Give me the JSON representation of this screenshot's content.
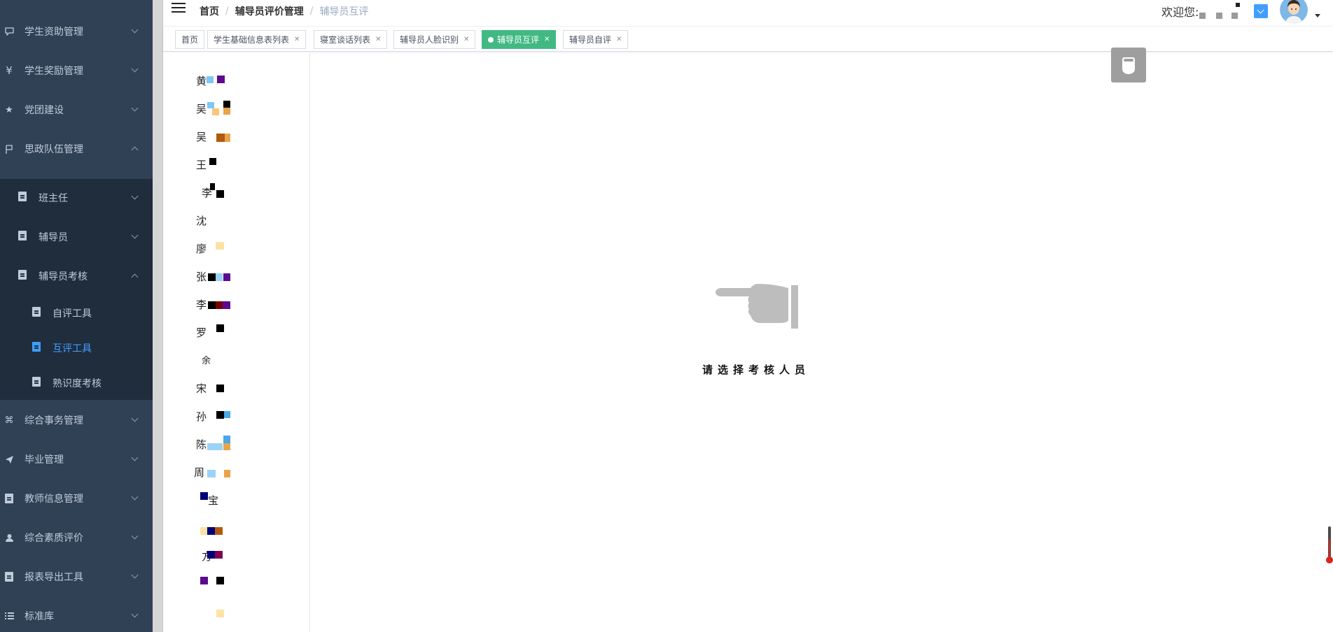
{
  "sidebar": {
    "items": [
      {
        "label": "学生资助管理",
        "icon": "chat-icon"
      },
      {
        "label": "学生奖励管理",
        "icon": "yen-icon"
      },
      {
        "label": "党团建设",
        "icon": "star-icon"
      },
      {
        "label": "思政队伍管理",
        "icon": "flag-icon"
      },
      {
        "label": "综合事务管理",
        "icon": "command-icon"
      },
      {
        "label": "毕业管理",
        "icon": "send-icon"
      },
      {
        "label": "教师信息管理",
        "icon": "document-icon"
      },
      {
        "label": "综合素质评价",
        "icon": "user-icon"
      },
      {
        "label": "报表导出工具",
        "icon": "document-icon"
      },
      {
        "label": "标准库",
        "icon": "list-icon"
      }
    ],
    "submenu": [
      {
        "label": "班主任"
      },
      {
        "label": "辅导员"
      },
      {
        "label": "辅导员考核"
      }
    ],
    "subsubmenu": [
      {
        "label": "自评工具"
      },
      {
        "label": "互评工具",
        "active": true
      },
      {
        "label": "熟识度考核"
      }
    ],
    "active_color": "#409eff",
    "bg_color": "#304156"
  },
  "header": {
    "breadcrumb": [
      "首页",
      "辅导员评价管理",
      "辅导员互评"
    ],
    "welcome": "欢迎您:"
  },
  "tags": [
    {
      "label": "首页",
      "closable": false
    },
    {
      "label": "学生基础信息表列表",
      "closable": true
    },
    {
      "label": "寝室谈话列表",
      "closable": true
    },
    {
      "label": "辅导员人脸识别",
      "closable": true
    },
    {
      "label": "辅导员互评",
      "closable": true,
      "active": true
    },
    {
      "label": "辅导员自评",
      "closable": true
    }
  ],
  "persons": [
    "黄",
    "吴",
    "吴",
    "王",
    "李",
    "沈",
    "廖",
    "张",
    "李",
    "罗",
    "余",
    "宋",
    "孙",
    "陈",
    "周",
    "宝",
    "",
    "方",
    "",
    ""
  ],
  "main": {
    "prompt": "请选择考核人员",
    "icon": "pointing-hand-icon"
  },
  "colors": {
    "tag_active": "#42b983",
    "float_button": "#9e9e9e"
  }
}
